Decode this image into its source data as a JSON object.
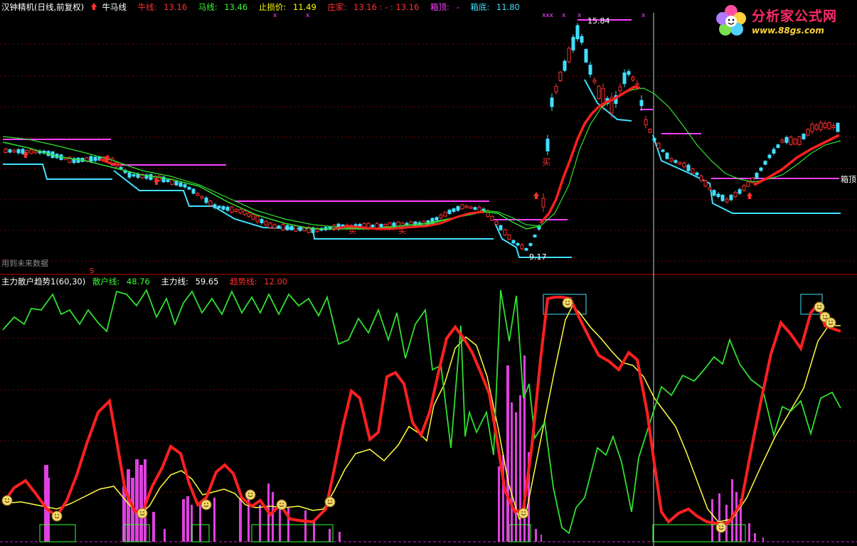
{
  "window": {
    "title": "汉钟精机(日线,前复权)"
  },
  "main_panel": {
    "indicator_name": "牛马线",
    "fields": [
      {
        "label": "牛线:",
        "value": "13.16",
        "color": "#ff3030"
      },
      {
        "label": "马线:",
        "value": "13.46",
        "color": "#30ff30"
      },
      {
        "label": "止损价:",
        "value": "11.49",
        "color": "#ffff00"
      },
      {
        "label": "庄家:",
        "value": "13.16 : - : 13.16",
        "color": "#ff3030"
      },
      {
        "label": "箱顶:",
        "value": "-",
        "color": "#ff40ff"
      },
      {
        "label": "箱底:",
        "value": "11.80",
        "color": "#40e0ff"
      }
    ],
    "annotations": {
      "high_price": "15.84",
      "low_price": "9.17",
      "buy_label": "买",
      "box_top_label": "箱顶",
      "footnote": "用到未来数据",
      "s_marker": "S"
    }
  },
  "sub_panel": {
    "indicator_name": "主力散户趋势1(60,30)",
    "fields": [
      {
        "label": "散户线:",
        "value": "48.76",
        "color": "#30ff30"
      },
      {
        "label": "主力线:",
        "value": "59.65",
        "color": "#ffffff"
      },
      {
        "label": "趋势线:",
        "value": "12.00",
        "color": "#ff3030"
      }
    ]
  },
  "logo": {
    "title": "分析家公式网",
    "url": "www.88gs.com"
  },
  "colors": {
    "background": "#000000",
    "up_candle": "#ff3030",
    "down_candle": "#40e0ff",
    "bull_line": "#ff2020",
    "horse_line": "#30e030",
    "box_top": "#ff40ff",
    "box_bottom": "#40e0ff",
    "retail_line": "#30ff30",
    "trend_line": "#ff2020",
    "main_force_line": "#ffff40",
    "volume_bar": "#e040e0",
    "grid": "#8b0000"
  }
}
